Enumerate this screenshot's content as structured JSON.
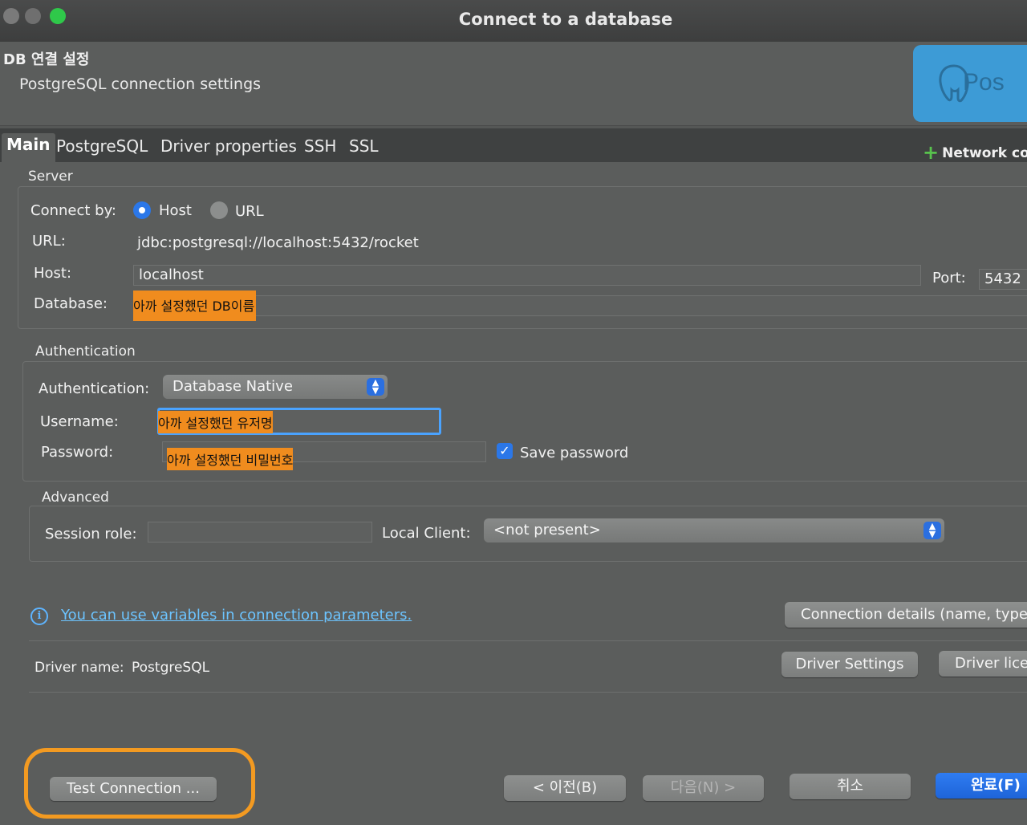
{
  "window": {
    "title": "Connect to a database"
  },
  "header": {
    "title": "DB 연결 설정",
    "subtitle": "PostgreSQL connection settings",
    "logo_text": "Pos"
  },
  "tabs": [
    {
      "label": "Main"
    },
    {
      "label": "PostgreSQL"
    },
    {
      "label": "Driver properties"
    },
    {
      "label": "SSH"
    },
    {
      "label": "SSL"
    }
  ],
  "network_config_label": "Network conf",
  "server": {
    "group_label": "Server",
    "connect_by_label": "Connect by:",
    "host_option": "Host",
    "url_option": "URL",
    "url_label": "URL:",
    "url_value": "jdbc:postgresql://localhost:5432/rocket",
    "host_label": "Host:",
    "host_value": "localhost",
    "port_label": "Port:",
    "port_value": "5432",
    "database_label": "Database:",
    "database_value": "아까 설정했던 DB이름"
  },
  "auth": {
    "group_label": "Authentication",
    "auth_label": "Authentication:",
    "auth_value": "Database Native",
    "username_label": "Username:",
    "username_value": "아까 설정했던 유저명",
    "password_label": "Password:",
    "password_value": "아까 설정했던 비밀번호",
    "save_password_label": "Save password"
  },
  "advanced": {
    "group_label": "Advanced",
    "session_role_label": "Session role:",
    "local_client_label": "Local Client:",
    "local_client_value": "<not present>"
  },
  "info_link": "You can use variables in connection parameters.",
  "connection_details_btn": "Connection details (name, type, ...)",
  "driver": {
    "name_label": "Driver name:",
    "name_value": "PostgreSQL",
    "settings_btn": "Driver Settings",
    "license_btn": "Driver license"
  },
  "footer": {
    "test_btn": "Test Connection ...",
    "prev_btn": "< 이전(B)",
    "next_btn": "다음(N) >",
    "cancel_btn": "취소",
    "finish_btn": "완료(F)"
  },
  "colors": {
    "accent": "#2b77e8",
    "highlight": "#f08c1e",
    "annotation_ring": "#f39a21",
    "link": "#6cc4ff"
  }
}
